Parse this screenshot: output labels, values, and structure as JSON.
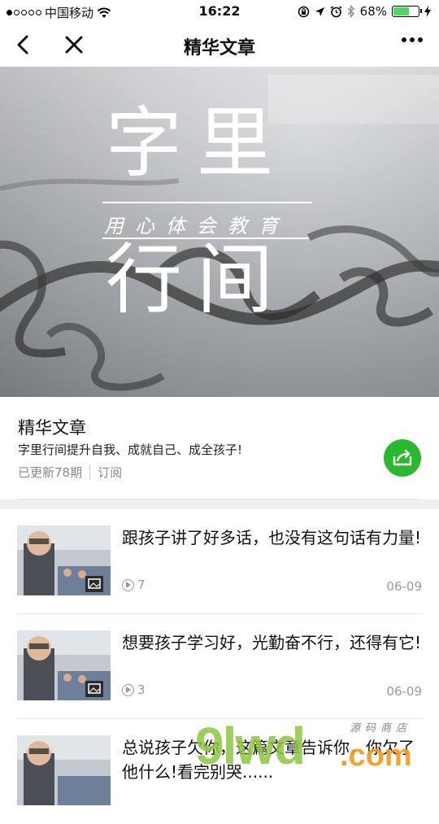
{
  "status_bar": {
    "carrier": "中国移动",
    "time": "16:22",
    "battery_percent": "68%",
    "battery_level": 0.68
  },
  "nav": {
    "title": "精华文章",
    "back_icon": "chevron-left-icon",
    "close_icon": "close-icon",
    "more_icon": "more-dots-icon"
  },
  "banner": {
    "line1": "字里",
    "subtitle": "用心体会教育",
    "line2": "行间"
  },
  "album": {
    "name": "精华文章",
    "description": "字里行间提升自我、成就自己、成全孩子!",
    "updated": "已更新78期",
    "subscribe": "订阅",
    "share_color": "#2ab82f"
  },
  "articles": [
    {
      "title": "跟孩子讲了好多话，也没有这句话有力量!",
      "views": "7",
      "date": "06-09"
    },
    {
      "title": "想要孩子学习好，光勤奋不行，还得有它!",
      "views": "3",
      "date": "06-09"
    },
    {
      "title": "总说孩子欠你，这篇文章告诉你，你欠了他什么!看完别哭......",
      "views": "",
      "date": ""
    }
  ],
  "watermark": {
    "main": "9lwd",
    "domain": ".com",
    "tagline": "源码商店"
  }
}
